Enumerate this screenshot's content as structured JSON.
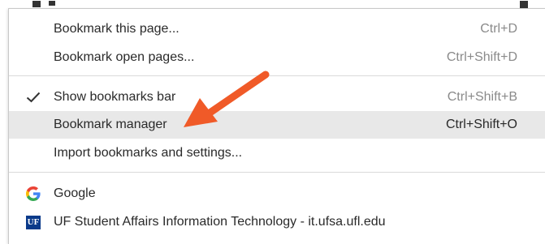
{
  "menu": {
    "items": [
      {
        "label": "Bookmark this page...",
        "shortcut": "Ctrl+D"
      },
      {
        "label": "Bookmark open pages...",
        "shortcut": "Ctrl+Shift+D"
      },
      {
        "label": "Show bookmarks bar",
        "shortcut": "Ctrl+Shift+B",
        "checked": true
      },
      {
        "label": "Bookmark manager",
        "shortcut": "Ctrl+Shift+O",
        "highlighted": true
      },
      {
        "label": "Import bookmarks and settings..."
      },
      {
        "label": "Google",
        "icon": "google-g-icon"
      },
      {
        "label": "UF Student Affairs Information Technology - it.ufsa.ufl.edu",
        "icon": "uf-favicon-icon",
        "icon_text": "UF"
      }
    ]
  },
  "colors": {
    "highlight": "#e8e8e8",
    "arrow": "#f05a28",
    "uf_blue": "#0a3a8a"
  }
}
